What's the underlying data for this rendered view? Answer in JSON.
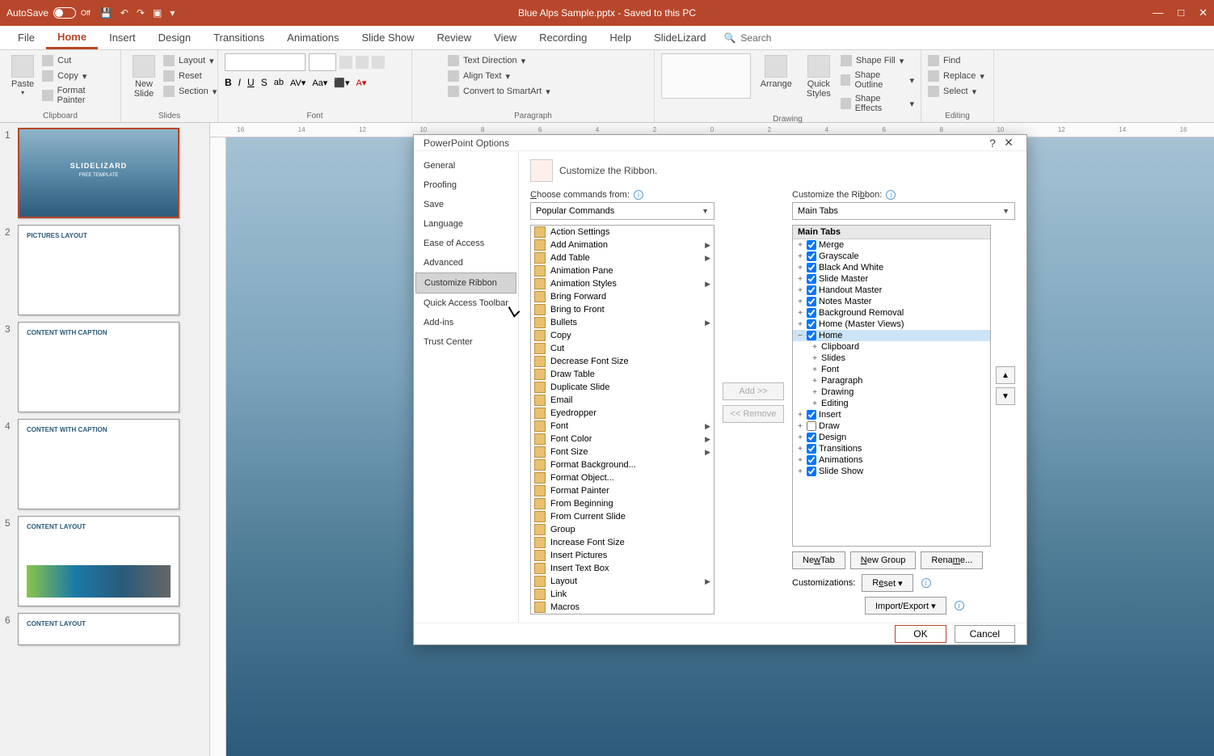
{
  "titlebar": {
    "autosave": "AutoSave",
    "off": "Off",
    "filename": "Blue Alps Sample.pptx  -  Saved to this PC"
  },
  "tabs": [
    "File",
    "Home",
    "Insert",
    "Design",
    "Transitions",
    "Animations",
    "Slide Show",
    "Review",
    "View",
    "Recording",
    "Help",
    "SlideLizard"
  ],
  "active_tab": "Home",
  "search_label": "Search",
  "ribbon": {
    "clipboard": {
      "label": "Clipboard",
      "paste": "Paste",
      "cut": "Cut",
      "copy": "Copy",
      "format_painter": "Format Painter"
    },
    "slides": {
      "label": "Slides",
      "new_slide": "New\nSlide",
      "layout": "Layout",
      "reset": "Reset",
      "section": "Section"
    },
    "font": {
      "label": "Font"
    },
    "paragraph": {
      "label": "Paragraph",
      "text_dir": "Text Direction",
      "align": "Align Text",
      "smartart": "Convert to SmartArt"
    },
    "drawing": {
      "label": "Drawing",
      "arrange": "Arrange",
      "quick": "Quick\nStyles",
      "fill": "Shape Fill",
      "outline": "Shape Outline",
      "effects": "Shape Effects"
    },
    "editing": {
      "label": "Editing",
      "find": "Find",
      "replace": "Replace",
      "select": "Select"
    }
  },
  "thumbs": {
    "t1_title": "SLIDELIZARD",
    "t1_sub": "FREE TEMPLATE",
    "t2": "PICTURES LAYOUT",
    "t3": "CONTENT WITH CAPTION",
    "t4": "CONTENT WITH CAPTION",
    "t5": "CONTENT LAYOUT",
    "t6": "CONTENT LAYOUT"
  },
  "dialog": {
    "title": "PowerPoint Options",
    "sidebar": [
      "General",
      "Proofing",
      "Save",
      "Language",
      "Ease of Access",
      "Advanced",
      "Customize Ribbon",
      "Quick Access Toolbar",
      "Add-ins",
      "Trust Center"
    ],
    "sidebar_sel": "Customize Ribbon",
    "header": "Customize the Ribbon.",
    "choose_label": "Choose commands from:",
    "choose_combo": "Popular Commands",
    "custom_label": "Customize the Ribbon:",
    "custom_combo": "Main Tabs",
    "commands": [
      "Action Settings",
      "Add Animation",
      "Add Table",
      "Animation Pane",
      "Animation Styles",
      "Bring Forward",
      "Bring to Front",
      "Bullets",
      "Copy",
      "Cut",
      "Decrease Font Size",
      "Draw Table",
      "Duplicate Slide",
      "Email",
      "Eyedropper",
      "Font",
      "Font Color",
      "Font Size",
      "Format Background...",
      "Format Object...",
      "Format Painter",
      "From Beginning",
      "From Current Slide",
      "Group",
      "Increase Font Size",
      "Insert Pictures",
      "Insert Text Box",
      "Layout",
      "Link",
      "Macros"
    ],
    "commands_submenu": [
      "Add Animation",
      "Add Table",
      "Animation Styles",
      "Bullets",
      "Font",
      "Font Color",
      "Font Size",
      "Layout"
    ],
    "tree_header": "Main Tabs",
    "tree": [
      {
        "label": "Merge",
        "checked": true,
        "exp": "+",
        "indent": 0
      },
      {
        "label": "Grayscale",
        "checked": true,
        "exp": "+",
        "indent": 0
      },
      {
        "label": "Black And White",
        "checked": true,
        "exp": "+",
        "indent": 0
      },
      {
        "label": "Slide Master",
        "checked": true,
        "exp": "+",
        "indent": 0
      },
      {
        "label": "Handout Master",
        "checked": true,
        "exp": "+",
        "indent": 0
      },
      {
        "label": "Notes Master",
        "checked": true,
        "exp": "+",
        "indent": 0
      },
      {
        "label": "Background Removal",
        "checked": true,
        "exp": "+",
        "indent": 0
      },
      {
        "label": "Home (Master Views)",
        "checked": true,
        "exp": "+",
        "indent": 0
      },
      {
        "label": "Home",
        "checked": true,
        "exp": "−",
        "indent": 0,
        "sel": true
      },
      {
        "label": "Clipboard",
        "exp": "+",
        "indent": 1
      },
      {
        "label": "Slides",
        "exp": "+",
        "indent": 1
      },
      {
        "label": "Font",
        "exp": "+",
        "indent": 1
      },
      {
        "label": "Paragraph",
        "exp": "+",
        "indent": 1
      },
      {
        "label": "Drawing",
        "exp": "+",
        "indent": 1
      },
      {
        "label": "Editing",
        "exp": "+",
        "indent": 1
      },
      {
        "label": "Insert",
        "checked": true,
        "exp": "+",
        "indent": 0
      },
      {
        "label": "Draw",
        "checked": false,
        "exp": "+",
        "indent": 0
      },
      {
        "label": "Design",
        "checked": true,
        "exp": "+",
        "indent": 0
      },
      {
        "label": "Transitions",
        "checked": true,
        "exp": "+",
        "indent": 0
      },
      {
        "label": "Animations",
        "checked": true,
        "exp": "+",
        "indent": 0
      },
      {
        "label": "Slide Show",
        "checked": true,
        "exp": "+",
        "indent": 0
      }
    ],
    "add": "Add >>",
    "remove": "<< Remove",
    "new_tab": "New Tab",
    "new_group": "New Group",
    "rename": "Rename...",
    "customizations": "Customizations:",
    "reset": "Reset",
    "import_export": "Import/Export",
    "ok": "OK",
    "cancel": "Cancel"
  }
}
